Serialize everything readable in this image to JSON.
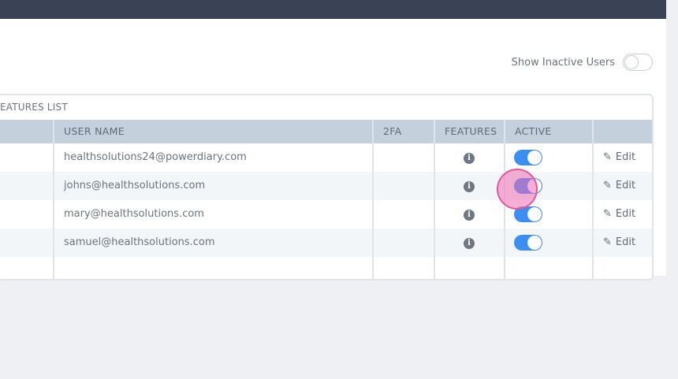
{
  "filter": {
    "show_inactive_label": "Show Inactive Users",
    "show_inactive": false
  },
  "table": {
    "caption": "EATURES LIST",
    "columns": {
      "user_name": "USER NAME",
      "twofa": "2FA",
      "features": "FEATURES",
      "active": "ACTIVE"
    },
    "rows": [
      {
        "user_name": "healthsolutions24@powerdiary.com",
        "twofa": "",
        "active": true,
        "edit_label": "Edit"
      },
      {
        "user_name": "johns@healthsolutions.com",
        "twofa": "",
        "active": true,
        "edit_label": "Edit"
      },
      {
        "user_name": "mary@healthsolutions.com",
        "twofa": "",
        "active": true,
        "edit_label": "Edit"
      },
      {
        "user_name": "samuel@healthsolutions.com",
        "twofa": "",
        "active": true,
        "edit_label": "Edit"
      }
    ]
  },
  "colors": {
    "topbar": "#3a4356",
    "header": "#c4d0dc",
    "toggle_on": "#3b8ff3",
    "click_marker": "#e0589b"
  },
  "icons": {
    "info": "info-circle-icon",
    "edit": "pencil-icon"
  }
}
